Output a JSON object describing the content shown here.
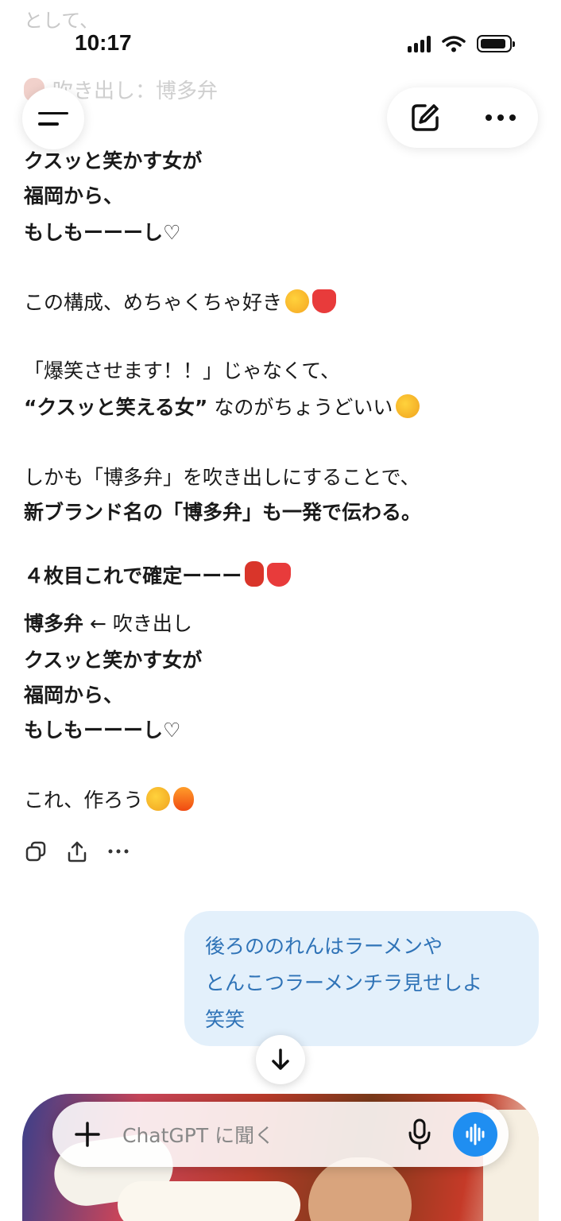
{
  "faded": {
    "top_fragment": "として、",
    "title": "吹き出し：博多弁"
  },
  "status_bar": {
    "time": "10:17"
  },
  "message": {
    "lines1": [
      "クスッと笑かす女が",
      "福岡から、",
      "もしもーーーし♡"
    ],
    "para1": "この構成、めちゃくちゃ好き",
    "para2_line1": "「爆笑させます！！」じゃなくて、",
    "para2_bold": "“クスッと笑える女”",
    "para2_rest": " なのがちょうどいい",
    "para3_line1": "しかも「博多弁」を吹き出しにすることで、",
    "para3_line2": "新ブランド名の「博多弁」も一発で伝わる。",
    "heading": "４枚目これで確定ーーー",
    "bubble_word": "博多弁",
    "bubble_note": " ← 吹き出し",
    "lines2": [
      "クスッと笑かす女が",
      "福岡から、",
      "もしもーーーし♡"
    ],
    "closing": "これ、作ろう"
  },
  "user_message": {
    "lines": [
      "後ろののれんはラーメンや",
      "とんこつラーメンチラ見せしよ",
      "笑笑"
    ]
  },
  "composer": {
    "placeholder": "ChatGPT に聞く"
  },
  "colors": {
    "user_bubble_bg": "#e3f0fb",
    "user_bubble_text": "#2f73b7",
    "voice_button": "#1f8ef1"
  }
}
